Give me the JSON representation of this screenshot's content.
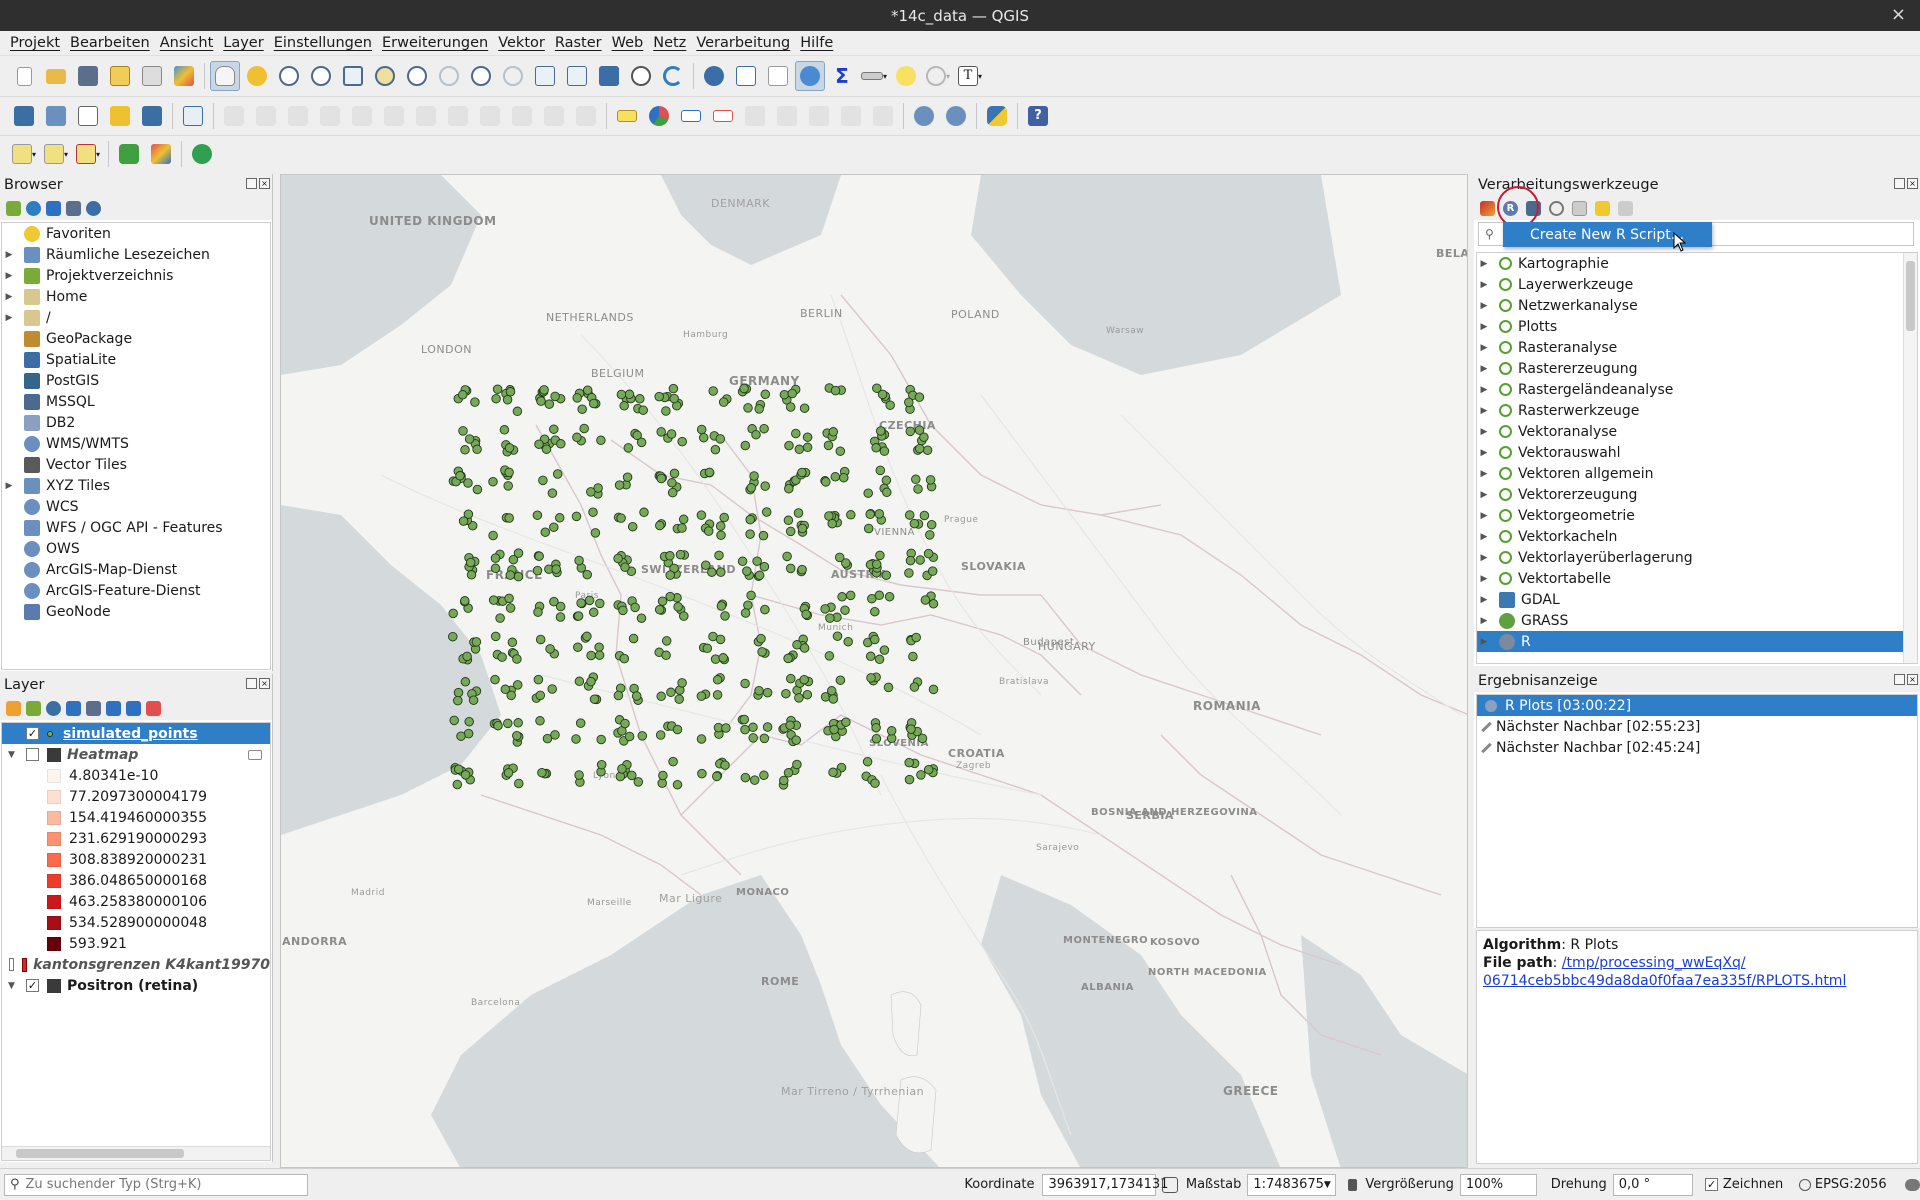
{
  "window": {
    "title": "*14c_data — QGIS",
    "close_glyph": "×"
  },
  "menu": [
    "Projekt",
    "Bearbeiten",
    "Ansicht",
    "Layer",
    "Einstellungen",
    "Erweiterungen",
    "Vektor",
    "Raster",
    "Web",
    "Netz",
    "Verarbeitung",
    "Hilfe"
  ],
  "browser": {
    "title": "Browser",
    "items": [
      {
        "label": "Favoriten",
        "icon": "star-icon",
        "expandable": false
      },
      {
        "label": "Räumliche Lesezeichen",
        "icon": "bookmark-icon",
        "expandable": true
      },
      {
        "label": "Projektverzeichnis",
        "icon": "project-folder-icon",
        "expandable": true
      },
      {
        "label": "Home",
        "icon": "folder-icon",
        "expandable": true
      },
      {
        "label": "/",
        "icon": "folder-icon",
        "expandable": true
      },
      {
        "label": "GeoPackage",
        "icon": "geopackage-icon",
        "expandable": false
      },
      {
        "label": "SpatiaLite",
        "icon": "spatialite-icon",
        "expandable": false
      },
      {
        "label": "PostGIS",
        "icon": "postgis-icon",
        "expandable": false
      },
      {
        "label": "MSSQL",
        "icon": "mssql-icon",
        "expandable": false
      },
      {
        "label": "DB2",
        "icon": "db2-icon",
        "expandable": false
      },
      {
        "label": "WMS/WMTS",
        "icon": "wms-icon",
        "expandable": false
      },
      {
        "label": "Vector Tiles",
        "icon": "vector-tiles-icon",
        "expandable": false
      },
      {
        "label": "XYZ Tiles",
        "icon": "xyz-tiles-icon",
        "expandable": true
      },
      {
        "label": "WCS",
        "icon": "wcs-icon",
        "expandable": false
      },
      {
        "label": "WFS / OGC API - Features",
        "icon": "wfs-icon",
        "expandable": false
      },
      {
        "label": "OWS",
        "icon": "ows-icon",
        "expandable": false
      },
      {
        "label": "ArcGIS-Map-Dienst",
        "icon": "arcgis-map-icon",
        "expandable": false
      },
      {
        "label": "ArcGIS-Feature-Dienst",
        "icon": "arcgis-feature-icon",
        "expandable": false
      },
      {
        "label": "GeoNode",
        "icon": "geonode-icon",
        "expandable": false
      }
    ]
  },
  "layers": {
    "title": "Layer",
    "simulated_points": "simulated_points",
    "heatmap": "Heatmap",
    "classes": [
      {
        "label": "4.80341e-10",
        "color": "#fff5f0"
      },
      {
        "label": "77.2097300004179",
        "color": "#fee0d2"
      },
      {
        "label": "154.419460000355",
        "color": "#fcbba1"
      },
      {
        "label": "231.629190000293",
        "color": "#fc9272"
      },
      {
        "label": "308.838920000231",
        "color": "#fb6a4a"
      },
      {
        "label": "386.048650000168",
        "color": "#ef3b2c"
      },
      {
        "label": "463.258380000106",
        "color": "#cb181d"
      },
      {
        "label": "534.528900000048",
        "color": "#a50f15"
      },
      {
        "label": "593.921",
        "color": "#67000d"
      }
    ],
    "kanton": "kantonsgrenzen K4kant19970",
    "positron": "Positron (retina)"
  },
  "map": {
    "labels": [
      {
        "text": "UNITED KINGDOM"
      },
      {
        "text": "LONDON"
      },
      {
        "text": "NETHERLANDS"
      },
      {
        "text": "BELGIUM"
      },
      {
        "text": "GERMANY"
      },
      {
        "text": "BERLIN"
      },
      {
        "text": "POLAND"
      },
      {
        "text": "DENMARK"
      },
      {
        "text": "FRANCE"
      },
      {
        "text": "SWITZERLAND"
      },
      {
        "text": "AUSTRIA"
      },
      {
        "text": "CZECHIA"
      },
      {
        "text": "SLOVAKIA"
      },
      {
        "text": "HUNGARY"
      },
      {
        "text": "VIENNA"
      },
      {
        "text": "Budapest"
      },
      {
        "text": "SLOVENIA"
      },
      {
        "text": "CROATIA"
      },
      {
        "text": "BOSNIA AND HERZEGOVINA"
      },
      {
        "text": "SERBIA"
      },
      {
        "text": "MONTENEGRO"
      },
      {
        "text": "KOSOVO"
      },
      {
        "text": "NORTH MACEDONIA"
      },
      {
        "text": "ALBANIA"
      },
      {
        "text": "GREECE"
      },
      {
        "text": "ROMANIA"
      },
      {
        "text": "BELARUS"
      },
      {
        "text": "ANDORRA"
      },
      {
        "text": "ROME"
      },
      {
        "text": "MONACO"
      },
      {
        "text": "Mar Ligure"
      },
      {
        "text": "Mar Tirreno / Tyrrhenian"
      },
      {
        "text": "Hamburg"
      },
      {
        "text": "Prague"
      },
      {
        "text": "Munich"
      },
      {
        "text": "Warsaw"
      },
      {
        "text": "Paris"
      },
      {
        "text": "Lyon"
      },
      {
        "text": "Marseille"
      },
      {
        "text": "Barcelona"
      },
      {
        "text": "Madrid"
      },
      {
        "text": "Zagreb"
      },
      {
        "text": "Sarajevo"
      },
      {
        "text": "Bratislava"
      }
    ]
  },
  "toolbox": {
    "title": "Verarbeitungswerkzeuge",
    "popup": "Create New R Script...",
    "items": [
      {
        "label": "Kartographie",
        "icon": "qgis-icon"
      },
      {
        "label": "Layerwerkzeuge",
        "icon": "qgis-icon"
      },
      {
        "label": "Netzwerkanalyse",
        "icon": "qgis-icon"
      },
      {
        "label": "Plotts",
        "icon": "qgis-icon"
      },
      {
        "label": "Rasteranalyse",
        "icon": "qgis-icon"
      },
      {
        "label": "Rastererzeugung",
        "icon": "qgis-icon"
      },
      {
        "label": "Rastergeländeanalyse",
        "icon": "qgis-icon"
      },
      {
        "label": "Rasterwerkzeuge",
        "icon": "qgis-icon"
      },
      {
        "label": "Vektoranalyse",
        "icon": "qgis-icon"
      },
      {
        "label": "Vektorauswahl",
        "icon": "qgis-icon"
      },
      {
        "label": "Vektoren allgemein",
        "icon": "qgis-icon"
      },
      {
        "label": "Vektorerzeugung",
        "icon": "qgis-icon"
      },
      {
        "label": "Vektorgeometrie",
        "icon": "qgis-icon"
      },
      {
        "label": "Vektorkacheln",
        "icon": "qgis-icon"
      },
      {
        "label": "Vektorlayerüberlagerung",
        "icon": "qgis-icon"
      },
      {
        "label": "Vektortabelle",
        "icon": "qgis-icon"
      },
      {
        "label": "GDAL",
        "icon": "gdal-icon"
      },
      {
        "label": "GRASS",
        "icon": "grass-icon"
      },
      {
        "label": "R",
        "icon": "r-icon"
      }
    ]
  },
  "results": {
    "title": "Ergebnisanzeige",
    "items": [
      {
        "label": "R Plots [03:00:22]",
        "icon": "r-icon"
      },
      {
        "label": "Nächster Nachbar [02:55:23]",
        "icon": "tool-icon"
      },
      {
        "label": "Nächster Nachbar [02:45:24]",
        "icon": "tool-icon"
      }
    ],
    "algorithm_label": "Algorithm",
    "algorithm_value": ": R Plots",
    "filepath_label": "File path",
    "filepath_sep": ": ",
    "filepath_line1": "/tmp/processing_wwEqXq/",
    "filepath_line2": "06714ceb5bbc49da8da0f0faa7ea335f/RPLOTS.html"
  },
  "status": {
    "search_placeholder": "Zu suchender Typ (Strg+K)",
    "coord_label": "Koordinate",
    "coord_value": "3963917,1734131",
    "scale_label": "Maßstab",
    "scale_value": "1:7483675",
    "magnify_label": "Vergrößerung",
    "magnify_value": "100%",
    "rotation_label": "Drehung",
    "rotation_value": "0,0 °",
    "render_label": "Zeichnen",
    "crs": "EPSG:2056"
  },
  "colors": {
    "selection": "#2f7fc8",
    "point_fill": "#78a85a",
    "point_stroke": "#1f3a16",
    "highlight_circle": "#c81a36"
  }
}
